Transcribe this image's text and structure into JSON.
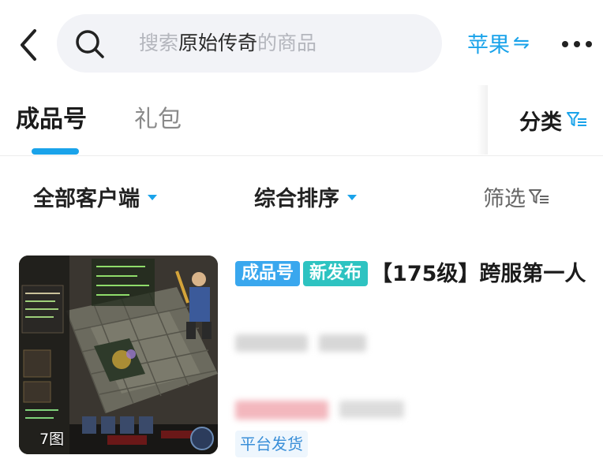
{
  "search": {
    "prefix": "搜索",
    "keyword": "原始传奇",
    "suffix": "的商品"
  },
  "header": {
    "platform_label": "苹果",
    "platform_icon": "swap-arrows-icon"
  },
  "tabs": [
    {
      "label": "成品号",
      "active": true
    },
    {
      "label": "礼包",
      "active": false
    }
  ],
  "category_label": "分类",
  "filters": {
    "client": "全部客户端",
    "sort": "综合排序",
    "screen": "筛选"
  },
  "product": {
    "tag_primary": "成品号",
    "tag_new": "新发布",
    "title": "【175级】跨服第一人",
    "image_count": "7图",
    "delivery": "平台发货"
  },
  "colors": {
    "accent": "#1aa3ea",
    "tag_goods": "#39a7ee",
    "tag_new": "#2ec3c1",
    "badge_bg": "#eef6fd"
  }
}
